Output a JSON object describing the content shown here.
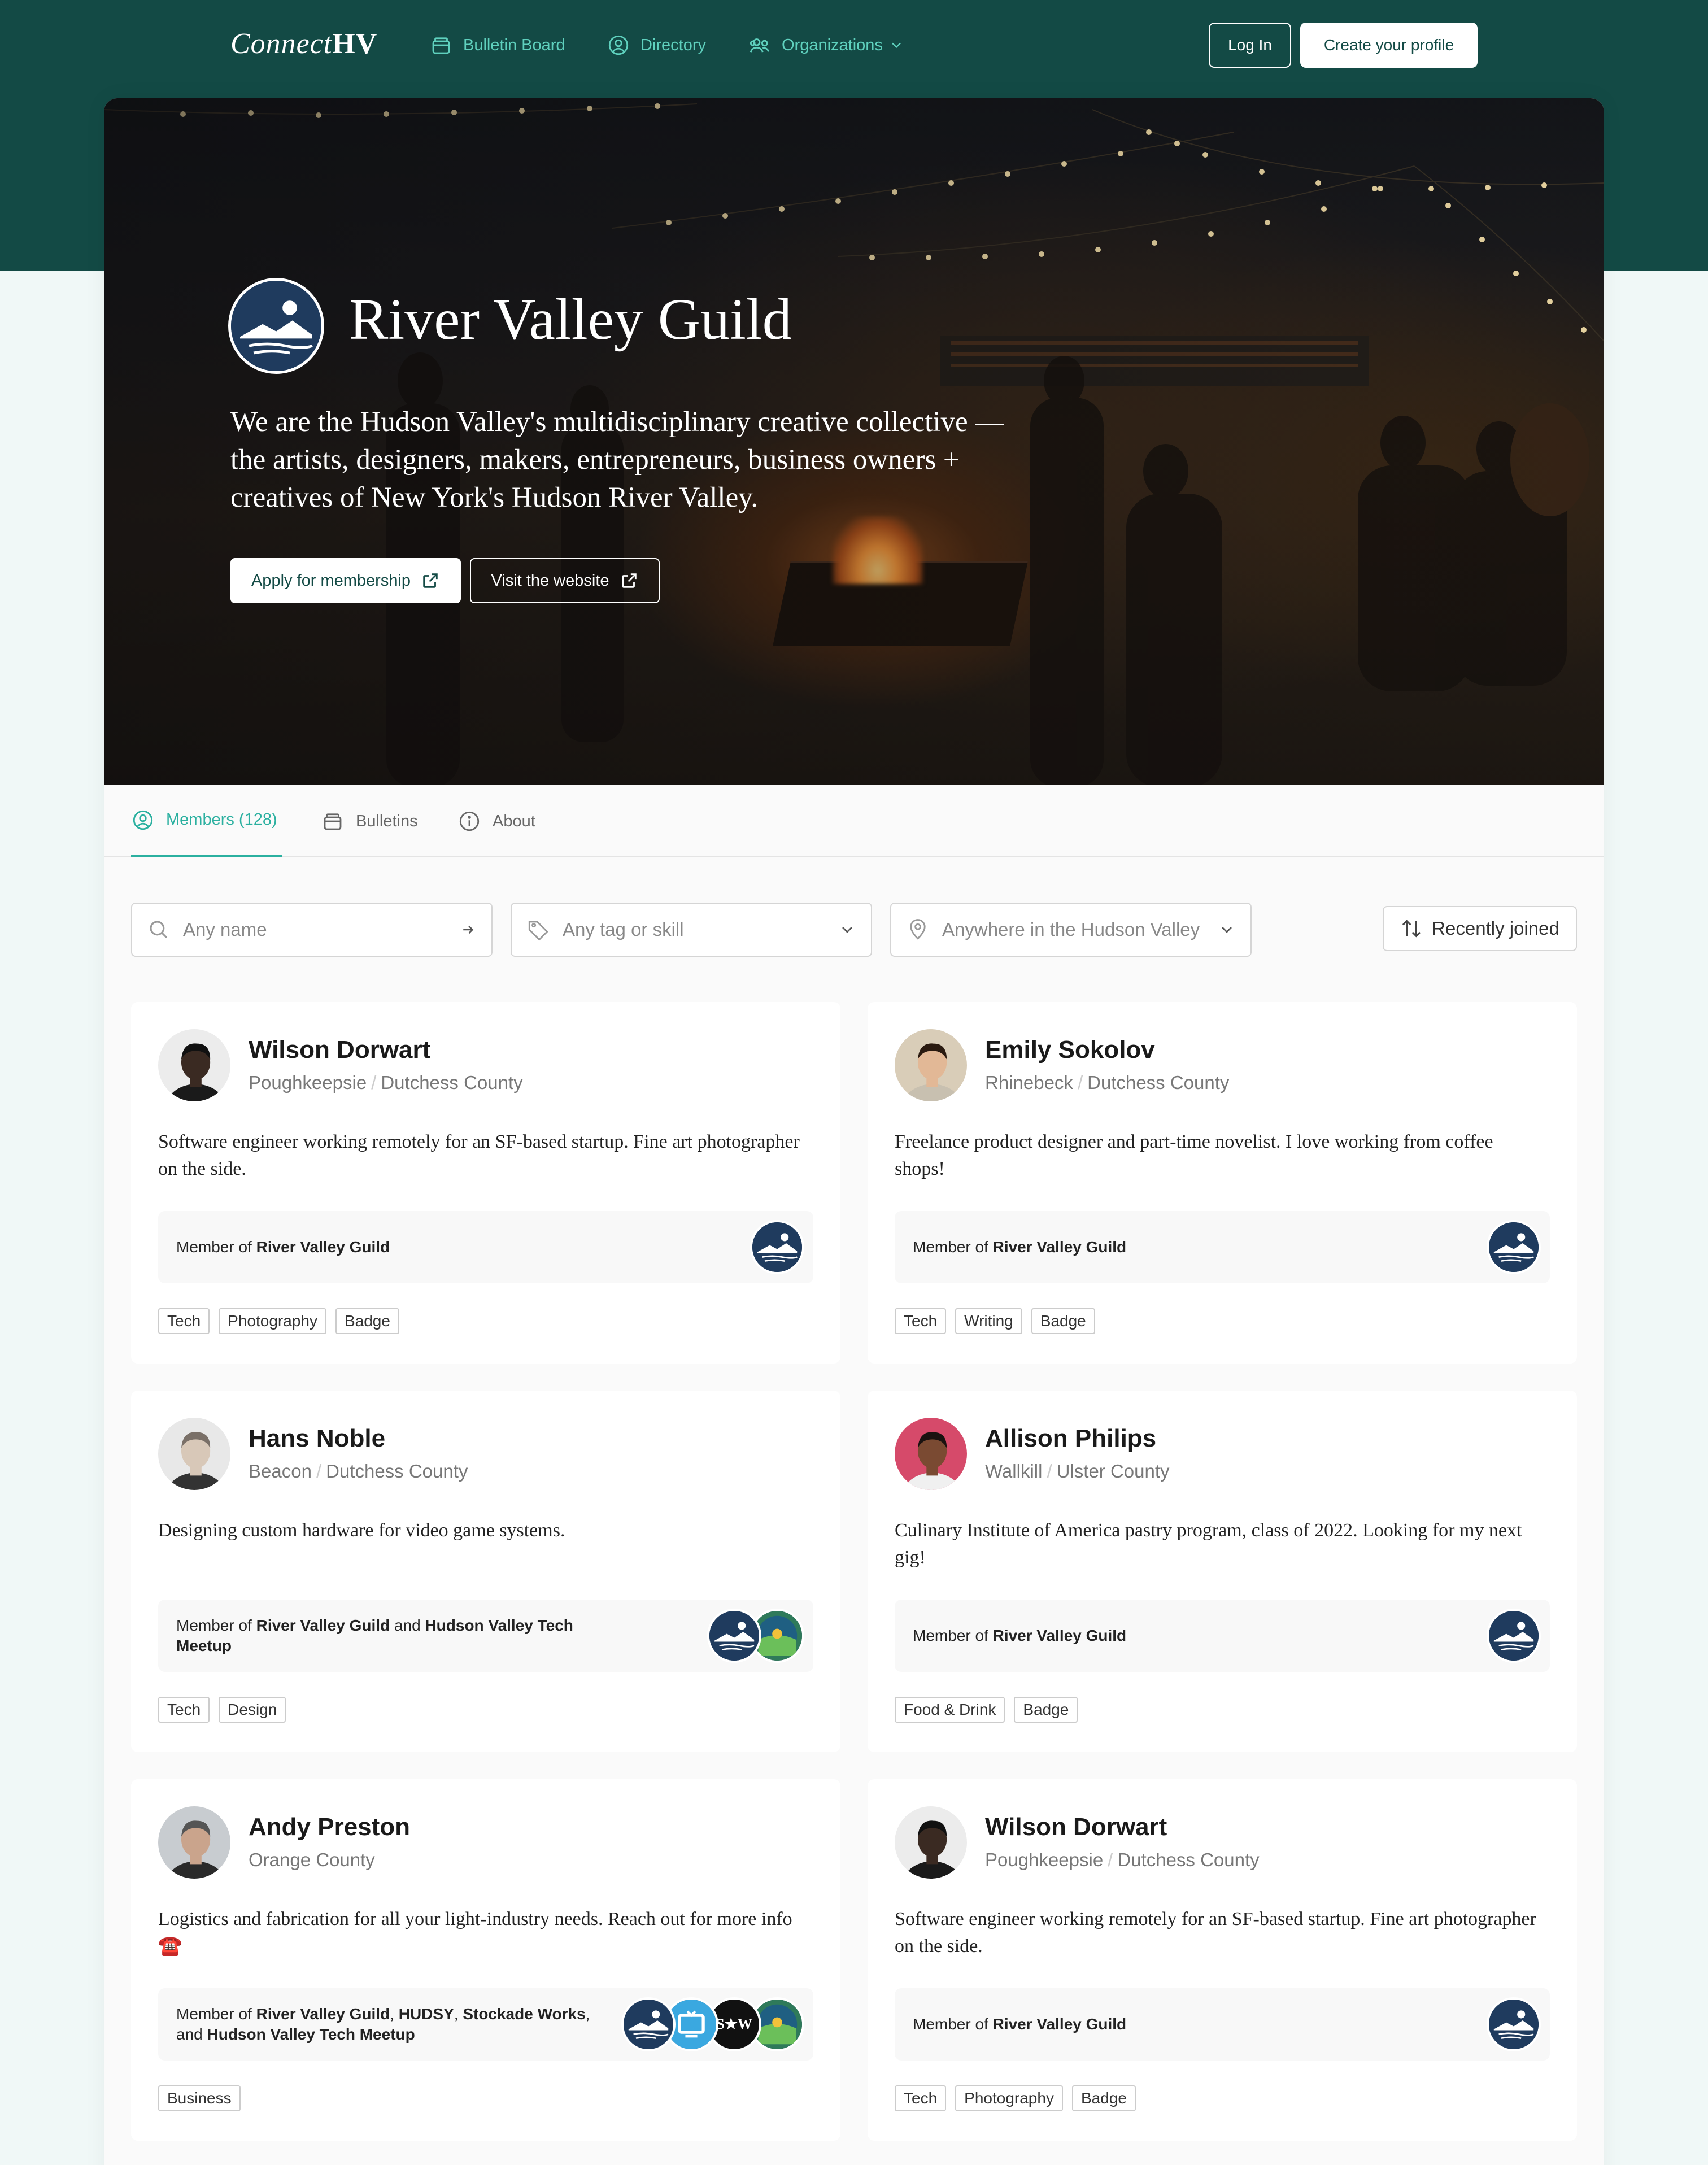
{
  "nav": {
    "logo_light": "Connect",
    "logo_bold": "HV",
    "links": [
      {
        "label": "Bulletin Board",
        "icon": "bulletin-icon"
      },
      {
        "label": "Directory",
        "icon": "user-circle-icon"
      },
      {
        "label": "Organizations",
        "icon": "users-icon"
      }
    ],
    "login": "Log In",
    "create": "Create your profile"
  },
  "hero": {
    "title": "River Valley Guild",
    "description": "We are the Hudson Valley's multidisciplinary creative collective — the artists, designers, makers, entrepreneurs, business owners + creatives of New York's Hudson River Valley.",
    "apply": "Apply for membership",
    "visit": "Visit the website"
  },
  "tabs": [
    {
      "label": "Members (128)",
      "icon": "user-circle-icon",
      "active": true
    },
    {
      "label": "Bulletins",
      "icon": "bulletin-icon",
      "active": false
    },
    {
      "label": "About",
      "icon": "info-icon",
      "active": false
    }
  ],
  "filters": {
    "name_placeholder": "Any name",
    "tag_placeholder": "Any tag or skill",
    "location_placeholder": "Anywhere in the Hudson Valley",
    "sort": "Recently joined"
  },
  "members": [
    {
      "name": "Wilson Dorwart",
      "city": "Poughkeepsie",
      "county": "Dutchess County",
      "bio": "Software engineer working remotely for an SF-based startup. Fine art photographer on the side.",
      "member_prefix": "Member of",
      "orgs": [
        "River Valley Guild"
      ],
      "org_icons": [
        "rvg"
      ],
      "tags": [
        "Tech",
        "Photography",
        "Badge"
      ]
    },
    {
      "name": "Emily Sokolov",
      "city": "Rhinebeck",
      "county": "Dutchess County",
      "bio": "Freelance product designer and part-time novelist. I love working from coffee shops!",
      "member_prefix": "Member of",
      "orgs": [
        "River Valley Guild"
      ],
      "org_icons": [
        "rvg"
      ],
      "tags": [
        "Tech",
        "Writing",
        "Badge"
      ]
    },
    {
      "name": "Hans Noble",
      "city": "Beacon",
      "county": "Dutchess County",
      "bio": "Designing custom hardware for video game systems.",
      "member_prefix": "Member of",
      "orgs": [
        "River Valley Guild",
        "Hudson Valley Tech Meetup"
      ],
      "org_icons": [
        "rvg",
        "hvtm"
      ],
      "tags": [
        "Tech",
        "Design"
      ]
    },
    {
      "name": "Allison Philips",
      "city": "Wallkill",
      "county": "Ulster County",
      "bio": "Culinary Institute of America pastry program, class of 2022. Looking for my next gig!",
      "member_prefix": "Member of",
      "orgs": [
        "River Valley Guild"
      ],
      "org_icons": [
        "rvg"
      ],
      "tags": [
        "Food & Drink",
        "Badge"
      ]
    },
    {
      "name": "Andy Preston",
      "city": "",
      "county": "Orange County",
      "bio": "Logistics and fabrication for all your light-industry needs. Reach out for more info ☎️",
      "member_prefix": "Member of",
      "orgs": [
        "River Valley Guild",
        "HUDSY",
        "Stockade Works",
        "Hudson Valley Tech Meetup"
      ],
      "org_icons": [
        "rvg",
        "hudsy",
        "sw",
        "hvtm"
      ],
      "tags": [
        "Business"
      ]
    },
    {
      "name": "Wilson Dorwart",
      "city": "Poughkeepsie",
      "county": "Dutchess County",
      "bio": "Software engineer working remotely for an SF-based startup. Fine art photographer on the side.",
      "member_prefix": "Member of",
      "orgs": [
        "River Valley Guild"
      ],
      "org_icons": [
        "rvg"
      ],
      "tags": [
        "Tech",
        "Photography",
        "Badge"
      ]
    }
  ],
  "org_icon_text": {
    "sw": "S★W"
  },
  "colors": {
    "brand": "#134a45",
    "accent": "#2bb0a0",
    "nav_link": "#5fd1be",
    "org_navy": "#1f3b5e"
  }
}
